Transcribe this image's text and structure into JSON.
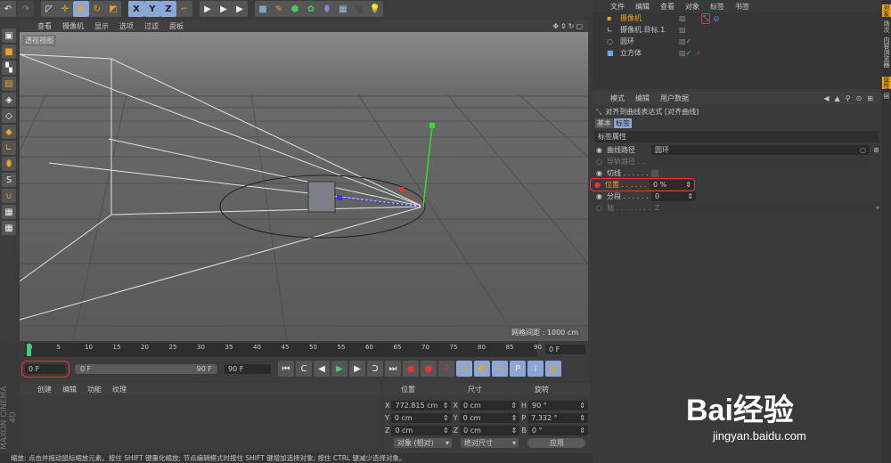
{
  "toolbar": {
    "icons": [
      "undo-icon",
      "redo-icon",
      "select-icon",
      "move-icon",
      "scale-icon",
      "rotate-icon",
      "live-select-icon",
      "x-axis-icon",
      "y-axis-icon",
      "z-axis-icon",
      "coordinate-system-icon",
      "render-view-icon",
      "render-picture-viewer-icon",
      "render-settings-icon",
      "cube-icon",
      "pen-icon",
      "subdivision-icon",
      "cloner-icon",
      "deformer-icon",
      "floor-icon",
      "camera-icon",
      "light-icon"
    ],
    "xyz": [
      "X",
      "Y",
      "Z"
    ]
  },
  "viewport": {
    "menu": [
      "查看",
      "摄像机",
      "显示",
      "选项",
      "过滤",
      "面板"
    ],
    "view_name": "透视视图",
    "grid_spacing": "网格间距 : 1000 cm"
  },
  "timeline": {
    "ticks": [
      "0",
      "5",
      "10",
      "15",
      "20",
      "25",
      "30",
      "35",
      "40",
      "45",
      "50",
      "55",
      "60",
      "65",
      "70",
      "75",
      "80",
      "85",
      "90"
    ],
    "current_frame_right": "0 F",
    "current_frame": "0 F",
    "range_start": "0 F",
    "range_end": "90 F",
    "max_frame": "90 F"
  },
  "objects": {
    "menu": [
      "文件",
      "编辑",
      "查看",
      "对象",
      "标签",
      "书签"
    ],
    "items": [
      {
        "name": "摄像机",
        "icon": "camera-icon",
        "selected": true
      },
      {
        "name": "摄像机.目标.1",
        "icon": "null-target-icon"
      },
      {
        "name": "圆环",
        "icon": "circle-icon"
      },
      {
        "name": "立方体",
        "icon": "cube-icon"
      }
    ]
  },
  "attributes": {
    "menu": [
      "模式",
      "编辑",
      "用户数据"
    ],
    "title": "对齐到曲线表达式 [对齐曲线]",
    "tabs": [
      "基本",
      "标签"
    ],
    "section": "标签属性",
    "props": [
      {
        "label": "曲线路径",
        "value": "圆环"
      },
      {
        "label": "导轨路径 . .",
        "value": ""
      },
      {
        "label": "切线 . . . . . .",
        "value": ""
      },
      {
        "label": "位置 . . . . . .",
        "value": "0 %"
      },
      {
        "label": "分段 . . . . . .",
        "value": "0"
      },
      {
        "label": "轴 . . . . . . . .",
        "value": "Z"
      }
    ]
  },
  "side_tabs": [
    "对象",
    "场次",
    "内容浏览器",
    "属性",
    "层"
  ],
  "materials": {
    "menu": [
      "创建",
      "编辑",
      "功能",
      "纹理"
    ]
  },
  "coords": {
    "headers": [
      "位置",
      "尺寸",
      "旋转"
    ],
    "rows": [
      [
        "X",
        "772.815 cm",
        "X",
        "0 cm",
        "H",
        "90 °"
      ],
      [
        "Y",
        "0 cm",
        "Y",
        "0 cm",
        "P",
        "7.332 °"
      ],
      [
        "Z",
        "0 cm",
        "Z",
        "0 cm",
        "B",
        "0 °"
      ]
    ],
    "mode": "对象 (相对)",
    "size_mode": "绝对尺寸",
    "apply": "应用"
  },
  "brand": "MAXON CINEMA 4D",
  "watermark": {
    "text": "Bai经验",
    "url": "jingyan.baidu.com"
  },
  "status": "缩放: 点击并拖动鼠标缩放元素。按住 SHIFT 键量化缩放; 节点编辑模式时按住 SHIFT 键增加选择对象; 按住 CTRL 键减少选择对象。",
  "colors": {
    "accent": "#f0a020",
    "highlight": "#e03030",
    "selected_btn": "#8aa7d8"
  }
}
